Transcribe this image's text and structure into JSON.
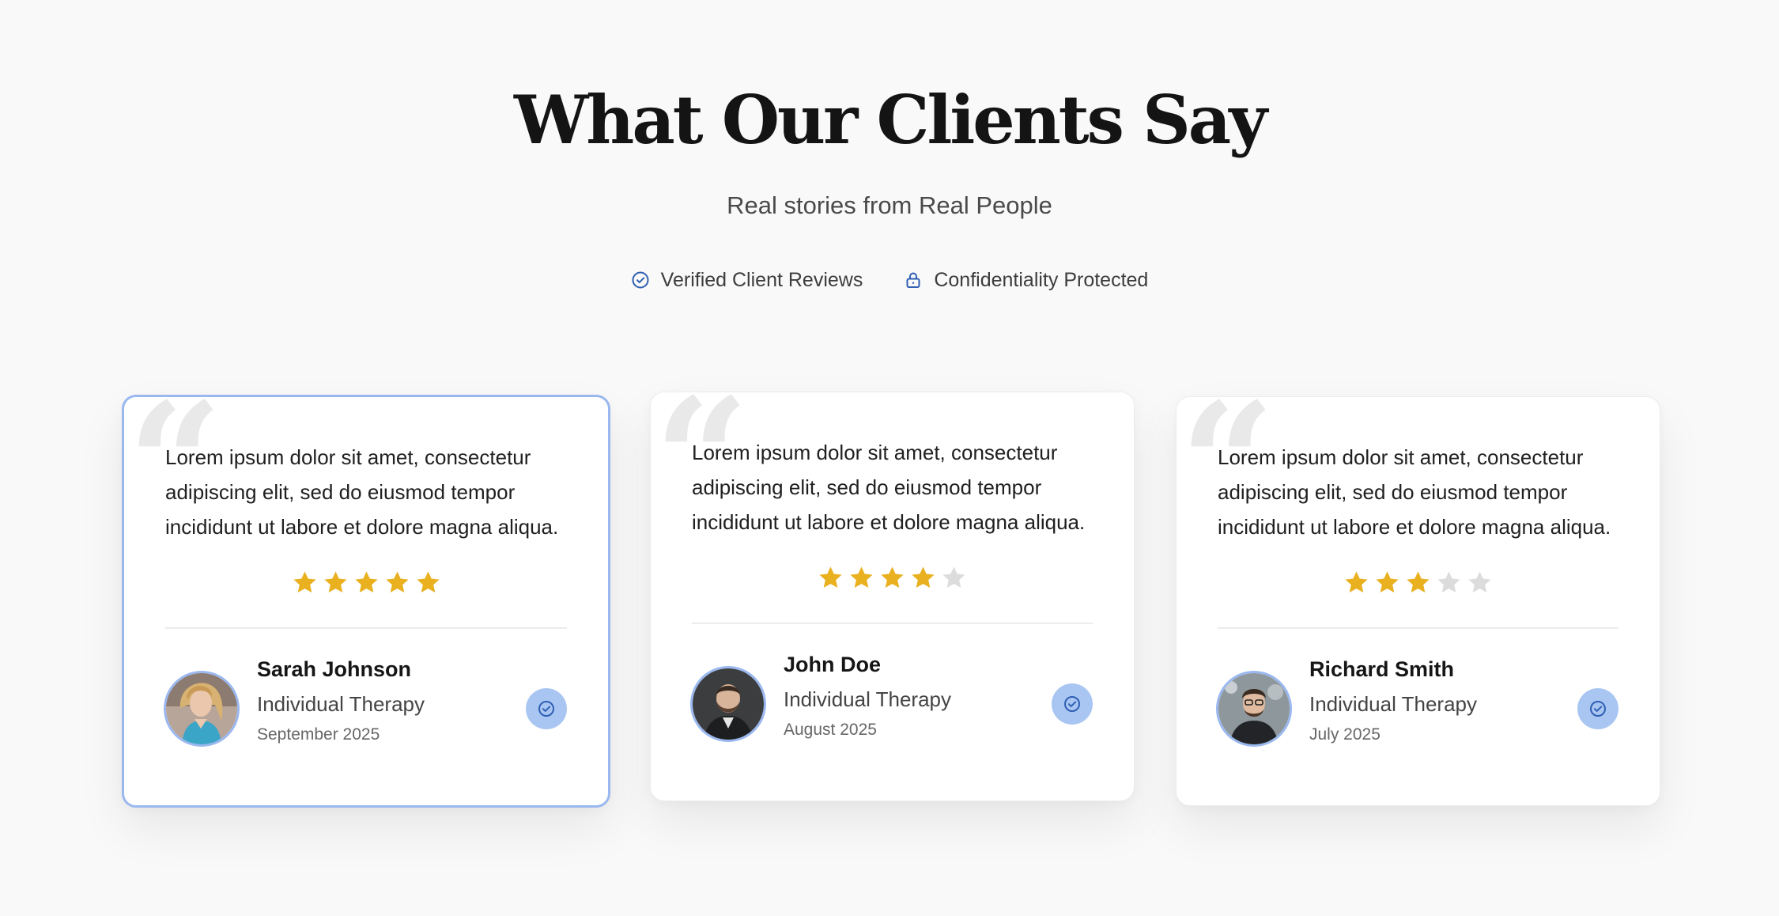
{
  "header": {
    "title": "What Our Clients Say",
    "subtitle": "Real stories from Real People"
  },
  "badges": [
    {
      "label": "Verified Client Reviews",
      "icon": "check-circle-icon"
    },
    {
      "label": "Confidentiality Protected",
      "icon": "lock-icon"
    }
  ],
  "colors": {
    "accent": "#2f5fb3",
    "star_filled": "#e9b01f",
    "star_empty": "#dcdcdc",
    "active_border": "#9ab8ef",
    "verified_bg": "#a9c6f3"
  },
  "testimonials": [
    {
      "quote": "Lorem ipsum dolor sit amet, consectetur adipiscing elit, sed do eiusmod tempor incididunt ut labore et dolore magna aliqua.",
      "rating": 5,
      "max_rating": 5,
      "name": "Sarah Johnson",
      "service": "Individual Therapy",
      "date": "September 2025",
      "active": true
    },
    {
      "quote": "Lorem ipsum dolor sit amet, consectetur adipiscing elit, sed do eiusmod tempor incididunt ut labore et dolore magna aliqua.",
      "rating": 4,
      "max_rating": 5,
      "name": "John Doe",
      "service": "Individual Therapy",
      "date": "August 2025",
      "active": false
    },
    {
      "quote": "Lorem ipsum dolor sit amet, consectetur adipiscing elit, sed do eiusmod tempor incididunt ut labore et dolore magna aliqua.",
      "rating": 3,
      "max_rating": 5,
      "name": "Richard Smith",
      "service": "Individual Therapy",
      "date": "July 2025",
      "active": false
    }
  ]
}
